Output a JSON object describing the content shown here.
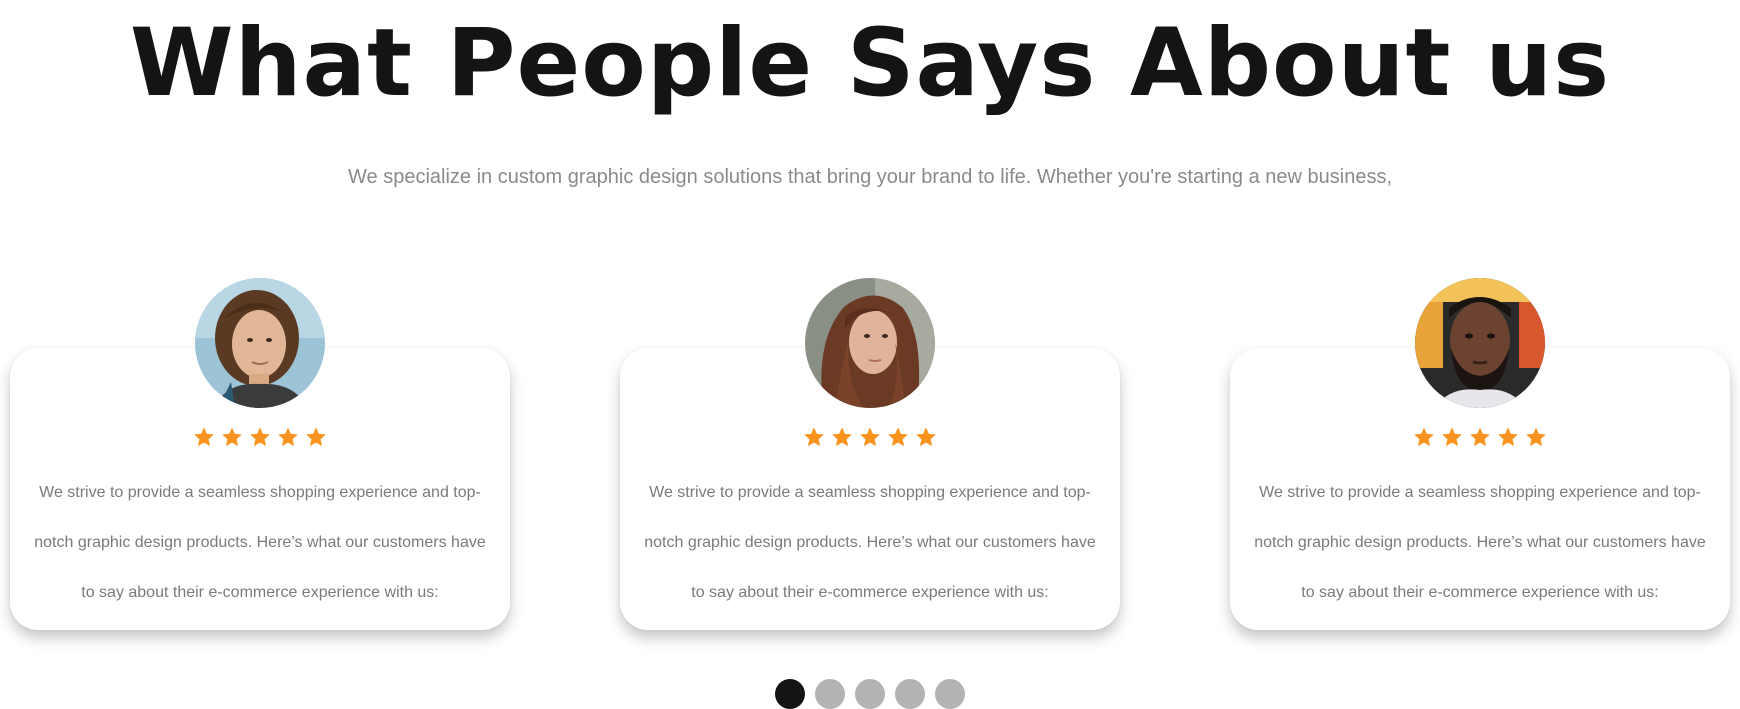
{
  "section": {
    "title": "What People Says About us",
    "subtitle": "We specialize in custom graphic design solutions that bring your brand to life. Whether you're starting a new business,"
  },
  "colors": {
    "star": "#F7931E",
    "dot_active": "#141414",
    "dot_inactive": "#B3B3B3",
    "quote_text": "#7A7A7A"
  },
  "testimonials": [
    {
      "avatar": "avatar-young-man-long-hair",
      "rating": 5,
      "quote": "We strive to provide a seamless shopping experience and top-notch graphic design products. Here’s what our customers have to say about their e-commerce experience with us:"
    },
    {
      "avatar": "avatar-woman-long-hair",
      "rating": 5,
      "quote": "We strive to provide a seamless shopping experience and top-notch graphic design products. Here’s what our customers have to say about their e-commerce experience with us:"
    },
    {
      "avatar": "avatar-bearded-man",
      "rating": 5,
      "quote": "We strive to provide a seamless shopping experience and top-notch graphic design products. Here’s what our customers have to say about their e-commerce experience with us:"
    }
  ],
  "pagination": {
    "count": 5,
    "active_index": 0
  }
}
